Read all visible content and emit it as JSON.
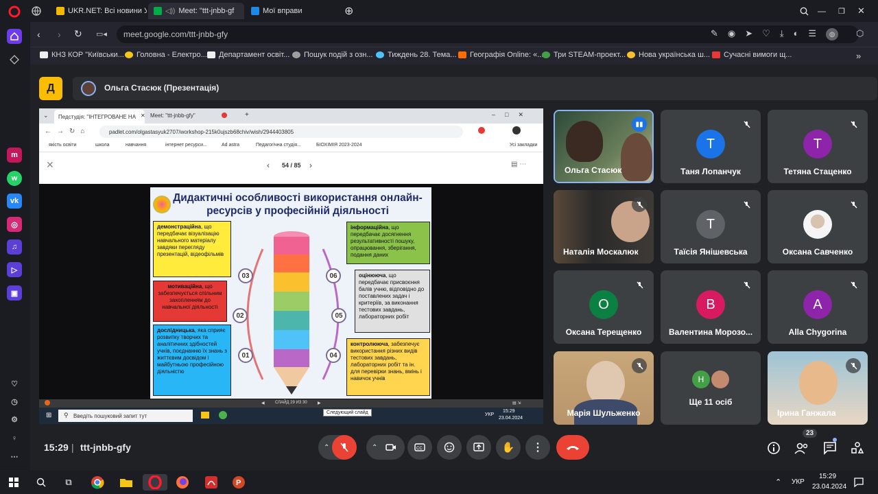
{
  "browser": {
    "tabs": [
      {
        "title": "UKR.NET: Всі новини Укр"
      },
      {
        "title": "Meet: \"ttt-jnbb-gf"
      },
      {
        "title": "Мої вправи"
      }
    ],
    "url": "meet.google.com/ttt-jnbb-gfy",
    "bookmarks": [
      "КНЗ КОР \"Київськи...",
      "Головна - Електро...",
      "Департамент освіт...",
      "Пошук подій з озн...",
      "Тиждень 28. Тема...",
      "Географія Online: «...",
      "Три STEAM-проект...",
      "Нова українська ш...",
      "Сучасні вимоги щ..."
    ]
  },
  "meet": {
    "presenter_title": "Ольга Стасюк (Презентація)",
    "meeting_code": "ttt-jnbb-gfy",
    "time": "15:29",
    "participant_count": "23",
    "more_count_label": "Ще 11 осіб",
    "participants": [
      {
        "name": "Ольга Стасюк",
        "type": "video",
        "speaking": true
      },
      {
        "name": "Таня Лопанчук",
        "initial": "T",
        "color": "#1a73e8"
      },
      {
        "name": "Тетяна Стаценко",
        "initial": "T",
        "color": "#8e24aa"
      },
      {
        "name": "Наталія Москалюк",
        "type": "video"
      },
      {
        "name": "Таїсія Янішевська",
        "initial": "T",
        "color": "#5f6368"
      },
      {
        "name": "Оксана Савченко",
        "type": "photo"
      },
      {
        "name": "Оксана Терещенко",
        "initial": "O",
        "color": "#0b8043"
      },
      {
        "name": "Валентина Морозо...",
        "initial": "B",
        "color": "#d81b60"
      },
      {
        "name": "Alla Chygorina",
        "initial": "A",
        "color": "#8e24aa"
      },
      {
        "name": "Марія Шульженко",
        "type": "video"
      },
      {
        "name": "Ірина Ганжала",
        "type": "video"
      }
    ]
  },
  "shared": {
    "tabs": [
      "Педстудія: \"ІНТЕГРОВАНЕ НА",
      "Meet: \"ttt-jnbb-gfy\""
    ],
    "url": "padlet.com/olgastasyuk2707/workshop-215k0ujszb68chiv/wish/2944403805",
    "bookmarks": [
      "якість освіти",
      "школа",
      "навчання",
      "інтернет ресурси...",
      "Ad astra",
      "Педагогічна студія...",
      "БІОХІМІЯ 2023-2024",
      "Усі закладки"
    ],
    "page_counter": "54 / 85",
    "slide_title": "Дидактичні особливості використання онлайн-ресурсів у професійній діяльності",
    "boxes": [
      {
        "bold": "демонстраційна",
        "text": ", що передбачає візуалізацію навчального матеріалу завдяки перегляду презентацій, відеофільмів"
      },
      {
        "bold": "мотиваційна",
        "text": ", що забезпечується спільним захопленням до навчальної діяльності"
      },
      {
        "bold": "дослідницька",
        "text": ", яка сприяє розвитку творчих та аналітичних здібностей учнів, поєднанню їх знань з життєвим досвідом і майбутньою професійною діяльністю"
      },
      {
        "bold": "інформаційна",
        "text": ", що передбачає досягнення результативності пошуку, опрацювання, зберігання, подання даних"
      },
      {
        "bold": "оцінююча",
        "text": ", що передбачає присвоєння балів учню, відповідно до поставлених задач і критеріїв, за виконання тестових завдань, лабораторних робіт"
      },
      {
        "bold": "контролююча",
        "text": ", забезпечує використання різних видів тестових завдань, лабораторних робіт та ін. для перевірки знань, вмінь і навичок учнів"
      }
    ],
    "numbers": [
      "01",
      "02",
      "03",
      "04",
      "05",
      "06"
    ],
    "slide_status": "СЛАЙД 29 ИЗ 30",
    "tooltip": "Следующий слайд",
    "search_placeholder": "Введіть пошуковий запит тут",
    "lang": "УКР",
    "time": "15:29",
    "date": "23.04.2024"
  },
  "taskbar": {
    "lang": "УКР",
    "time": "15:29",
    "date": "23.04.2024"
  },
  "colors": {
    "accent": "#8ab4f8",
    "end_call": "#ea4335",
    "app_badge": "#fbbc04"
  }
}
